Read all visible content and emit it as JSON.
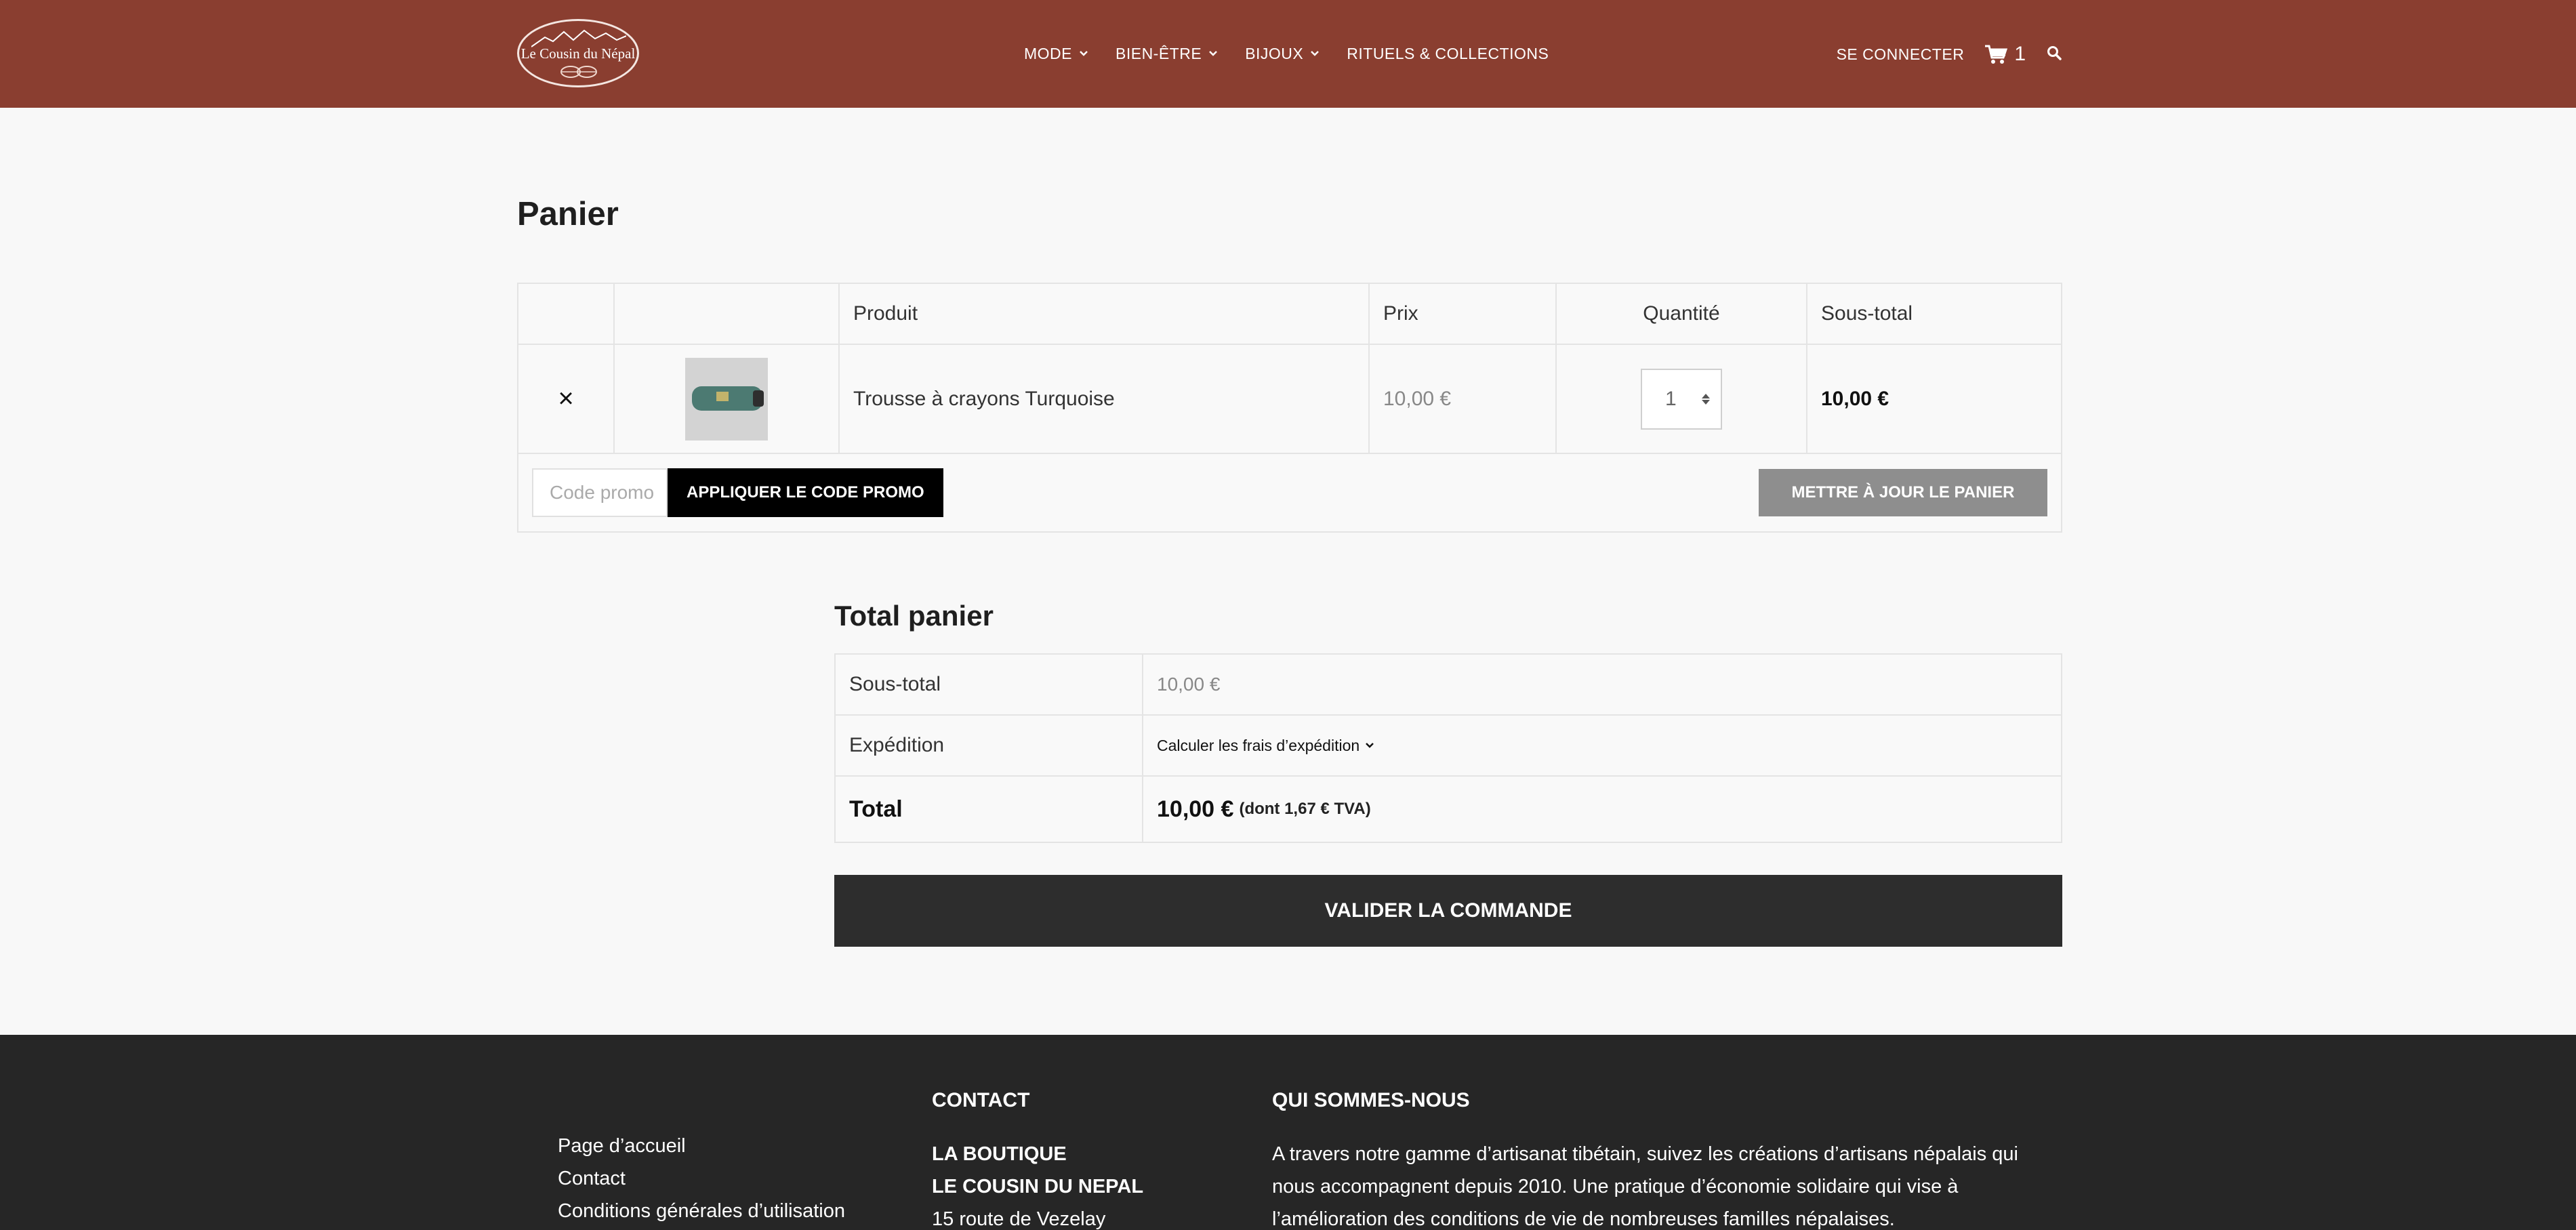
{
  "header": {
    "logo_text": "Le Cousin du Népal",
    "nav": [
      {
        "label": "MODE",
        "has_dropdown": true
      },
      {
        "label": "BIEN-ÊTRE",
        "has_dropdown": true
      },
      {
        "label": "BIJOUX",
        "has_dropdown": true
      },
      {
        "label": "RITUELS & COLLECTIONS",
        "has_dropdown": false
      }
    ],
    "login_label": "SE CONNECTER",
    "cart_count": "1",
    "cart_icon": "cart-icon",
    "search_icon": "search-icon",
    "background_color": "#8a3e30"
  },
  "page": {
    "title": "Panier"
  },
  "cart_table": {
    "columns": [
      "",
      "",
      "Produit",
      "Prix",
      "Quantité",
      "Sous-total"
    ],
    "items": [
      {
        "remove_symbol": "×",
        "product_name": "Trousse à crayons Turquoise",
        "price": "10,00 €",
        "quantity": "1",
        "subtotal": "10,00 €"
      }
    ],
    "coupon_placeholder": "Code promo",
    "coupon_button": "APPLIQUER LE CODE PROMO",
    "update_button": "METTRE À JOUR LE PANIER"
  },
  "totals": {
    "title": "Total panier",
    "subtotal_label": "Sous-total",
    "subtotal_value": "10,00 €",
    "shipping_label": "Expédition",
    "shipping_select": "Calculer les frais d’expédition",
    "total_label": "Total",
    "total_value": "10,00 €",
    "tax_note": "(dont 1,67 € TVA)",
    "checkout_button": "VALIDER LA COMMANDE"
  },
  "footer": {
    "links": [
      "Page d’accueil",
      "Contact",
      "Conditions générales d’utilisation"
    ],
    "contact_title": "CONTACT",
    "contact_lines": [
      "LA BOUTIQUE",
      "LE COUSIN DU NEPAL",
      "15 route de Vezelay"
    ],
    "about_title": "QUI SOMMES-NOUS",
    "about_text": "A travers notre gamme d’artisanat tibétain, suivez les créations d’artisans népalais qui nous accompagnent depuis 2010. Une pratique d’économie solidaire qui vise à l’amélioration des conditions de vie de nombreuses familles népalaises."
  }
}
